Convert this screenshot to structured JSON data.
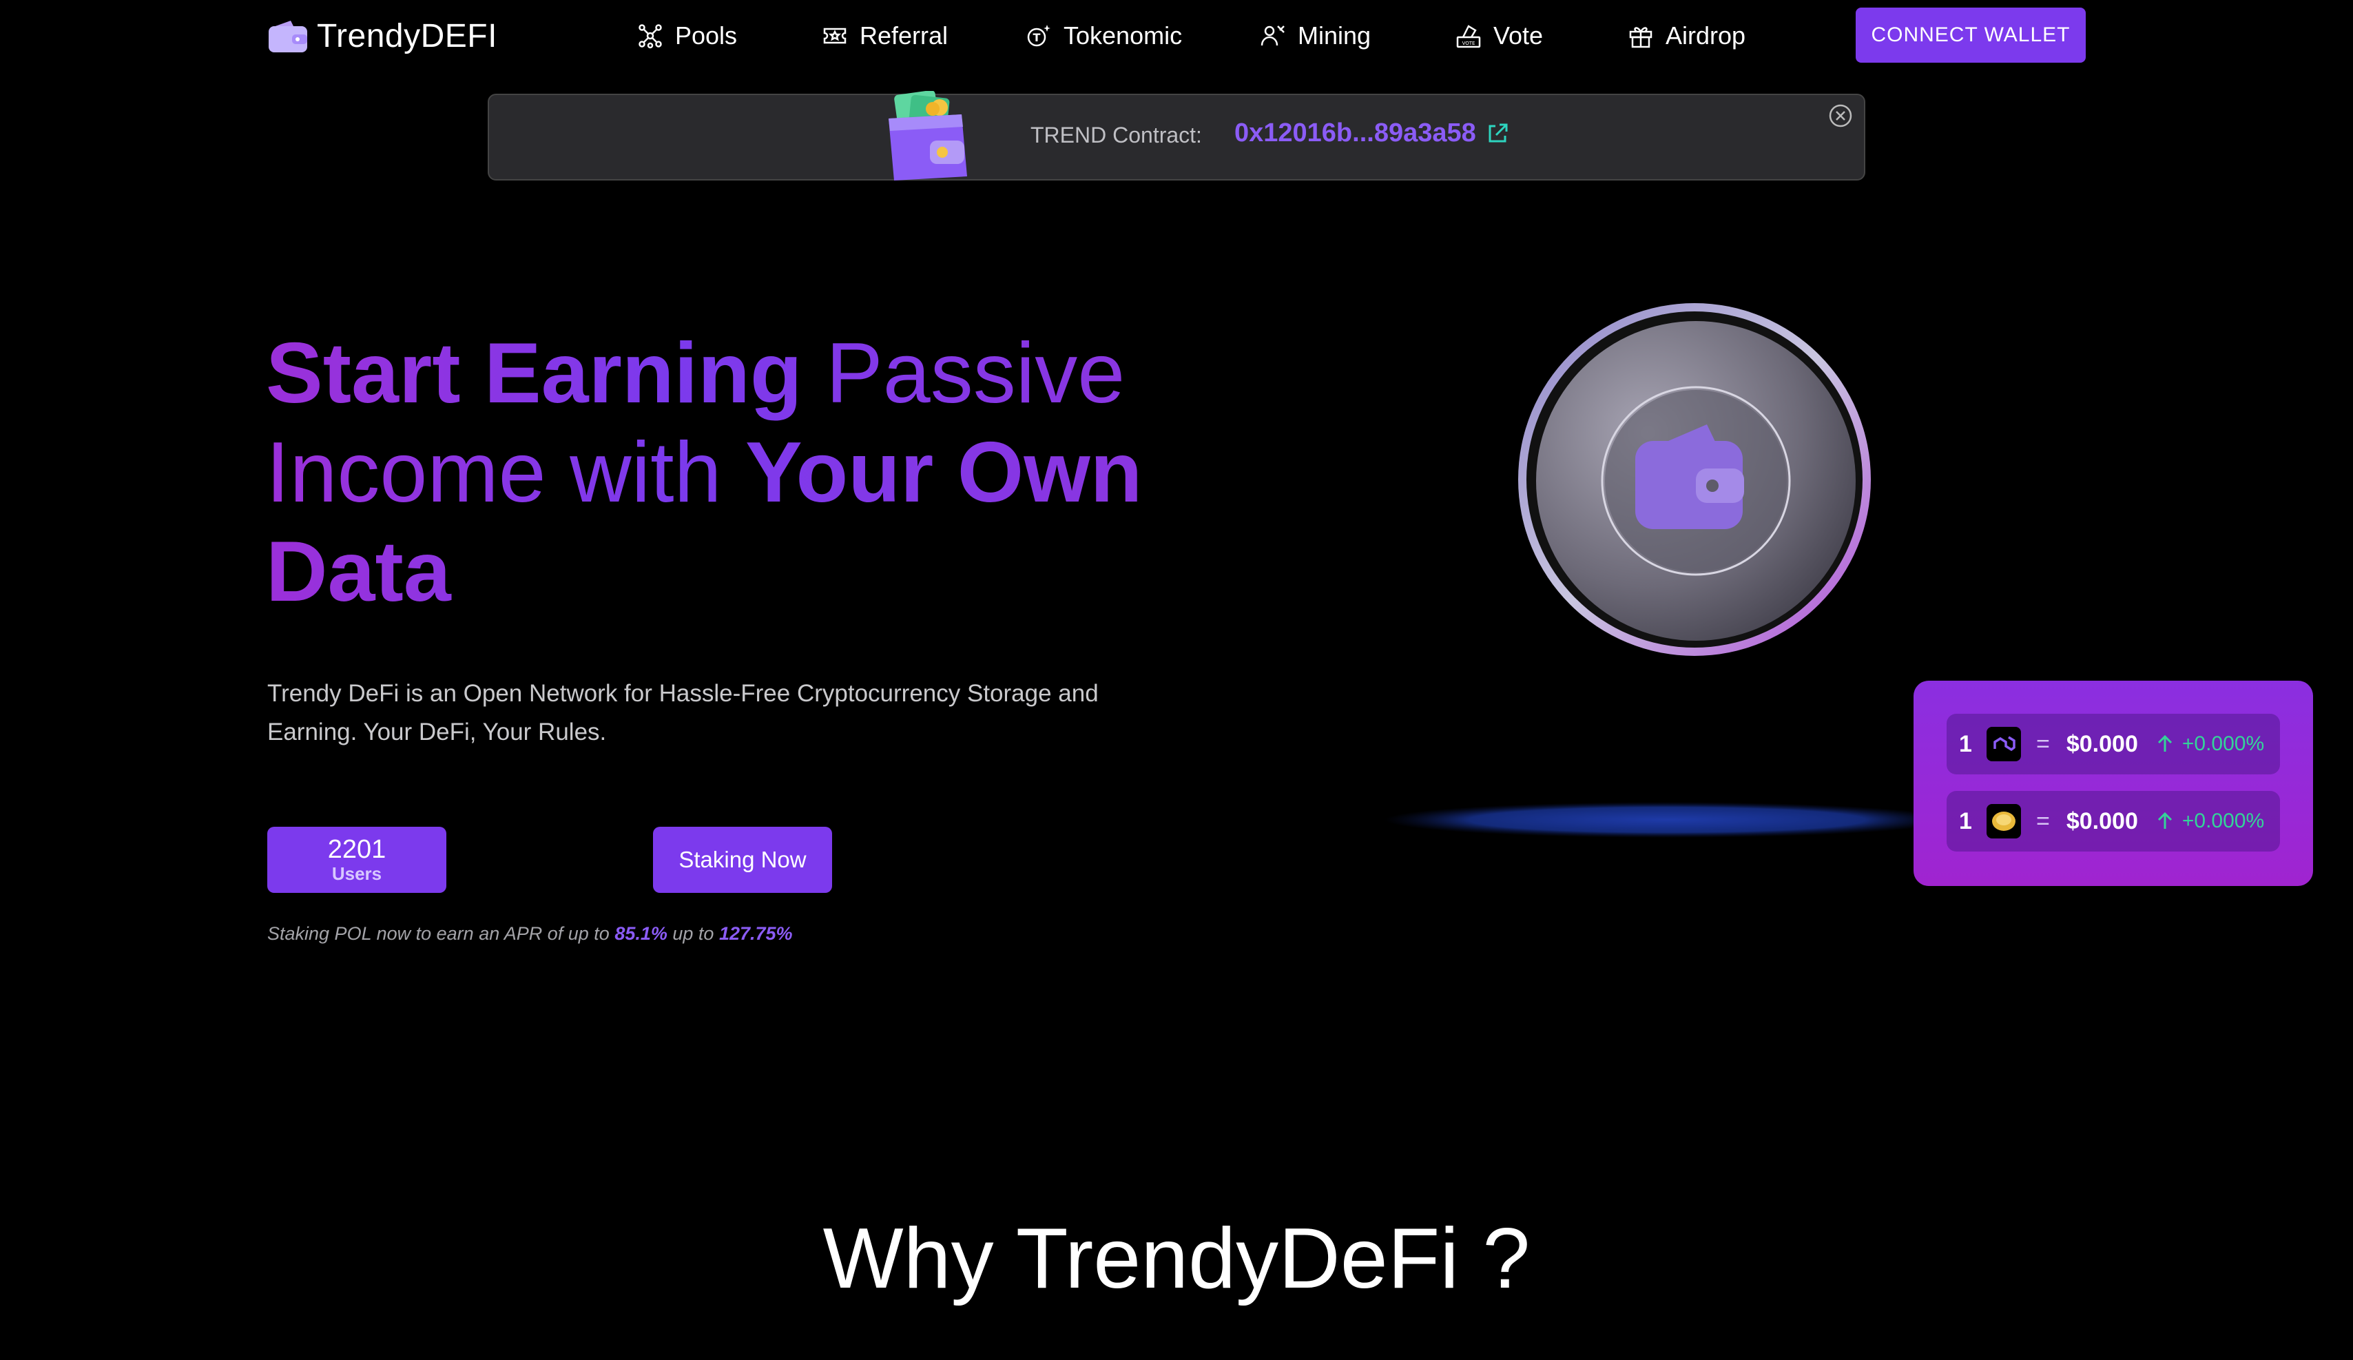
{
  "nav": {
    "brand": "TrendyDEFI",
    "items": [
      {
        "label": "Pools",
        "icon": "pools-icon"
      },
      {
        "label": "Referral",
        "icon": "ticket-icon"
      },
      {
        "label": "Tokenomic",
        "icon": "token-icon"
      },
      {
        "label": "Mining",
        "icon": "mining-icon"
      },
      {
        "label": "Vote",
        "icon": "vote-icon"
      },
      {
        "label": "Airdrop",
        "icon": "gift-icon"
      }
    ],
    "connect_label": "CONNECT WALLET"
  },
  "contract": {
    "label": "TREND Contract:",
    "address": "0x12016b...89a3a58"
  },
  "hero": {
    "title_part1": "Start Earning",
    "title_part2": " Passive Income with ",
    "title_part3": "Your Own Data",
    "description": "Trendy DeFi is an Open Network for Hassle-Free Cryptocurrency Storage and Earning. Your DeFi, Your Rules.",
    "users_count": "2201",
    "users_label": "Users",
    "stake_label": "Staking Now",
    "apr_prefix": "Staking POL now to earn an APR of up to ",
    "apr_value1": "85.1%",
    "apr_mid": " up to ",
    "apr_value2": "127.75%"
  },
  "prices": [
    {
      "qty": "1",
      "token": "pol-icon",
      "eq": "=",
      "price": "$0.000",
      "change": "+0.000%"
    },
    {
      "qty": "1",
      "token": "trend-coin-icon",
      "eq": "=",
      "price": "$0.000",
      "change": "+0.000%"
    }
  ],
  "why": {
    "title": "Why TrendyDeFi ?"
  },
  "colors": {
    "accent": "#7c3aed",
    "accent_text": "#8b5cf6",
    "positive": "#34d399",
    "background": "#000000"
  }
}
